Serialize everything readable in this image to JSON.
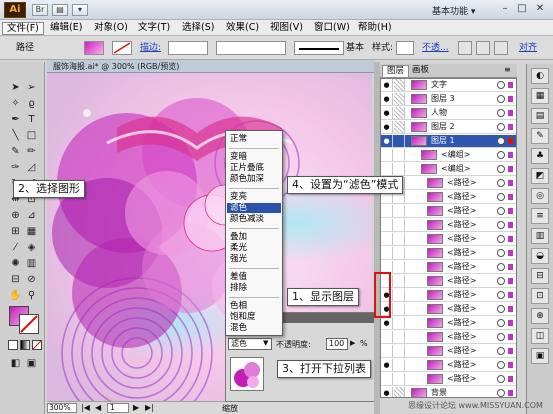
{
  "app": {
    "logo_text": "Ai",
    "workspace_label": "基本功能 ▾"
  },
  "menubar": {
    "items": [
      "文件(F)",
      "编辑(E)",
      "对象(O)",
      "文字(T)",
      "选择(S)",
      "效果(C)",
      "视图(V)",
      "窗口(W)",
      "帮助(H)"
    ]
  },
  "control_bar": {
    "selection_label": "路径",
    "stroke_label": "描边:",
    "stroke_style": "基本",
    "style_label": "样式:",
    "opacity_link": "不透...",
    "align_link": "对齐"
  },
  "document": {
    "tab_title": "服饰海报.ai* @ 300% (RGB/预览)",
    "zoom": "300%",
    "page": "1",
    "status_label": "缩放"
  },
  "blend_menu": {
    "groups": [
      [
        "正常"
      ],
      [
        "变暗",
        "正片叠底",
        "颜色加深"
      ],
      [
        "变亮",
        "滤色",
        "颜色减淡"
      ],
      [
        "叠加",
        "柔光",
        "强光"
      ],
      [
        "差值",
        "排除"
      ],
      [
        "色相",
        "饱和度",
        "混色",
        "明度"
      ]
    ],
    "selected": "滤色"
  },
  "transparency_panel": {
    "mode": "滤色",
    "opacity_label": "不透明度:",
    "opacity_value": "100",
    "opacity_unit": "%"
  },
  "layers_panel": {
    "tabs": [
      "图层",
      "画板"
    ],
    "rows": [
      {
        "name": "文字",
        "type": "layer",
        "eye": true,
        "lock": true
      },
      {
        "name": "图层 3",
        "type": "layer",
        "eye": true,
        "lock": true
      },
      {
        "name": "人物",
        "type": "layer",
        "eye": true,
        "lock": true
      },
      {
        "name": "图层 2",
        "type": "layer",
        "eye": true,
        "lock": true
      },
      {
        "name": "图层 1",
        "type": "layer-active",
        "eye": true,
        "lock": false
      },
      {
        "name": "<编组>",
        "type": "group",
        "eye": false,
        "lock": false
      },
      {
        "name": "<编组>",
        "type": "group",
        "eye": false,
        "lock": false
      },
      {
        "name": "<路径>",
        "type": "path",
        "eye": false,
        "lock": false
      },
      {
        "name": "<路径>",
        "type": "path",
        "eye": false,
        "lock": false
      },
      {
        "name": "<路径>",
        "type": "path",
        "eye": false,
        "lock": false
      },
      {
        "name": "<路径>",
        "type": "path",
        "eye": false,
        "lock": false
      },
      {
        "name": "<路径>",
        "type": "path",
        "eye": false,
        "lock": false
      },
      {
        "name": "<路径>",
        "type": "path",
        "eye": false,
        "lock": false
      },
      {
        "name": "<路径>",
        "type": "path",
        "eye": false,
        "lock": false
      },
      {
        "name": "<路径>",
        "type": "path",
        "eye": false,
        "lock": false
      },
      {
        "name": "<路径>",
        "type": "path",
        "eye": true,
        "lock": false
      },
      {
        "name": "<路径>",
        "type": "path",
        "eye": true,
        "lock": false
      },
      {
        "name": "<路径>",
        "type": "path",
        "eye": true,
        "lock": false
      },
      {
        "name": "<路径>",
        "type": "path",
        "eye": false,
        "lock": false
      },
      {
        "name": "<路径>",
        "type": "path",
        "eye": false,
        "lock": false
      },
      {
        "name": "<路径>",
        "type": "path",
        "eye": true,
        "lock": false
      },
      {
        "name": "<路径>",
        "type": "path",
        "eye": false,
        "lock": false
      },
      {
        "name": "背景",
        "type": "layer",
        "eye": true,
        "lock": true
      }
    ]
  },
  "callouts": {
    "c1": "1、显示图层",
    "c2": "2、选择图形",
    "c3": "3、打开下拉列表",
    "c4": "4、设置为“滤色”模式"
  },
  "colors": {
    "accent": "#2f56b0",
    "artwork_magenta": "#c21db8",
    "artwork_pink": "#f0a8e6",
    "highlight_red": "#e01010"
  },
  "watermark": "思缘设计论坛 www.MISSYUAN.COM"
}
